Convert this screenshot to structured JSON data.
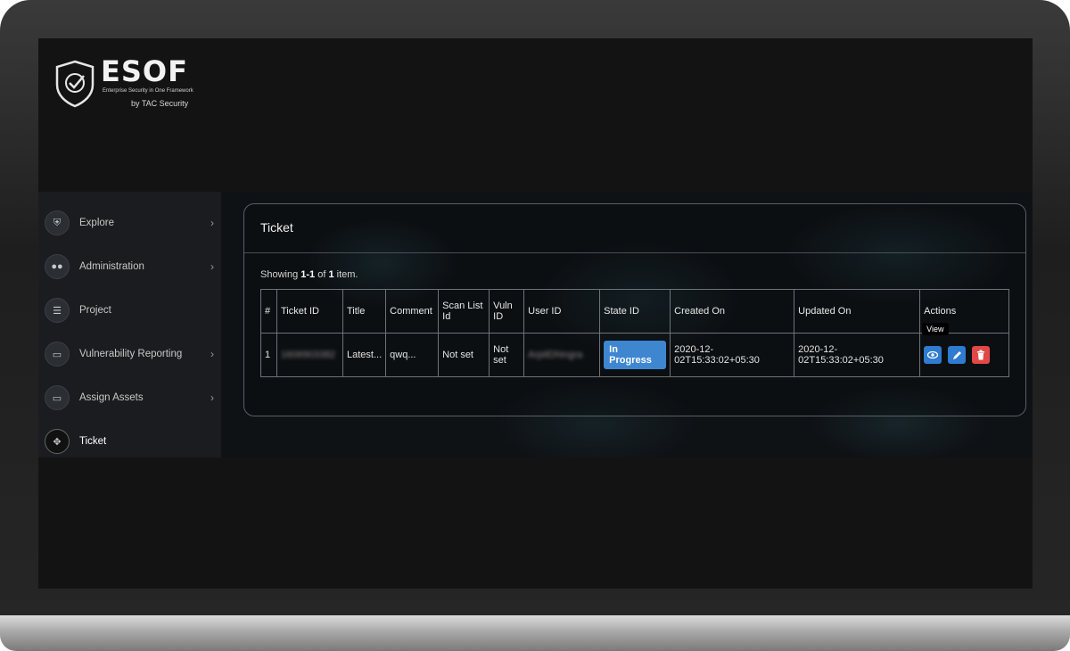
{
  "brand": {
    "name": "ESOF",
    "tagline": "Enterprise Security in One Framework",
    "byline": "by TAC Security"
  },
  "sidebar": {
    "items": [
      {
        "label": "Explore",
        "icon": "shield-icon",
        "has_chevron": true,
        "active": false
      },
      {
        "label": "Administration",
        "icon": "users-icon",
        "has_chevron": true,
        "active": false
      },
      {
        "label": "Project",
        "icon": "list-icon",
        "has_chevron": false,
        "active": false
      },
      {
        "label": "Vulnerability Reporting",
        "icon": "window-icon",
        "has_chevron": true,
        "active": false
      },
      {
        "label": "Assign Assets",
        "icon": "window-icon",
        "has_chevron": true,
        "active": false
      },
      {
        "label": "Ticket",
        "icon": "ticket-icon",
        "has_chevron": false,
        "active": true
      }
    ]
  },
  "card": {
    "title": "Ticket",
    "summary": {
      "prefix": "Showing ",
      "range": "1-1",
      "middle": " of ",
      "total": "1",
      "suffix": " item."
    }
  },
  "table": {
    "headers": [
      "#",
      "Ticket ID",
      "Title",
      "Comment",
      "Scan List Id",
      "Vuln ID",
      "User ID",
      "State ID",
      "Created On",
      "Updated On",
      "Actions"
    ],
    "rows": [
      {
        "num": "1",
        "ticket_id": "1606903382",
        "title": "Latest...",
        "comment": "qwq...",
        "scan_list_id": "Not set",
        "vuln_id": "Not set",
        "user_id": "ArpitDhingra",
        "state": "In Progress",
        "created_on": "2020-12-02T15:33:02+05:30",
        "updated_on": "2020-12-02T15:33:02+05:30"
      }
    ]
  },
  "tooltip": "View",
  "colors": {
    "state_badge": "#3f86d1",
    "view_button": "#2e7bd0",
    "edit_button": "#2e7bd0",
    "delete_button": "#e04848"
  }
}
